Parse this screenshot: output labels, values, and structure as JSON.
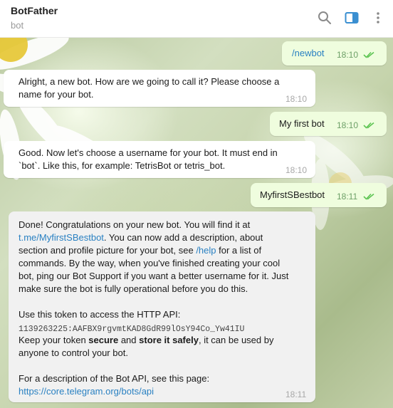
{
  "header": {
    "title": "BotFather",
    "subtitle": "bot",
    "icons": [
      "search-icon",
      "sidebar-toggle-icon",
      "more-vertical-icon"
    ],
    "accent": "#3a8fd1"
  },
  "messages": [
    {
      "direction": "out",
      "text": "/newbot",
      "time": "18:10",
      "status": "read"
    },
    {
      "direction": "in",
      "lines": [
        "Alright, a new bot. How are we going to call it? Please choose a",
        "name for your bot."
      ],
      "time": "18:10"
    },
    {
      "direction": "out",
      "text": "My first bot",
      "time": "18:10",
      "status": "read"
    },
    {
      "direction": "in",
      "lines": [
        "Good. Now let's choose a username for your bot. It must end in",
        "`bot`. Like this, for example: TetrisBot or tetris_bot."
      ],
      "time": "18:10"
    },
    {
      "direction": "out",
      "text": "MyfirstSBestbot",
      "time": "18:11",
      "status": "read"
    },
    {
      "direction": "in",
      "time": "18:11",
      "p1_l1": "Done! Congratulations on your new bot. You will find it at",
      "p1_link1": "t.me/MyfirstSBestbot",
      "p1_l2_rest": ". You can now add a description, about",
      "p1_l3": "section and profile picture for your bot, see ",
      "p1_link2": "/help",
      "p1_l3_rest": " for a list of",
      "p1_l4": "commands. By the way, when you've finished creating your cool",
      "p1_l5": "bot, ping our Bot Support if you want a better username for it. Just",
      "p1_l6": "make sure the bot is fully operational before you do this.",
      "p2_l1": "Use this token to access the HTTP API:",
      "token": "1139263225:AAFBX9rgvmtKAD8GdR99lOsY94Co_Yw41IU",
      "p2_l3a": "Keep your token ",
      "p2_secure": "secure",
      "p2_l3b": " and ",
      "p2_store": "store it safely",
      "p2_l3c": ", it can be used by",
      "p2_l4": "anyone to control your bot.",
      "p3_l1": "For a description of the Bot API, see this page:",
      "p3_link": "https://core.telegram.org/bots/api"
    }
  ],
  "colors": {
    "outgoing_bubble": "#effdde",
    "incoming_bubble": "#ffffff",
    "link": "#2a81c2",
    "read_check": "#5dc452"
  }
}
